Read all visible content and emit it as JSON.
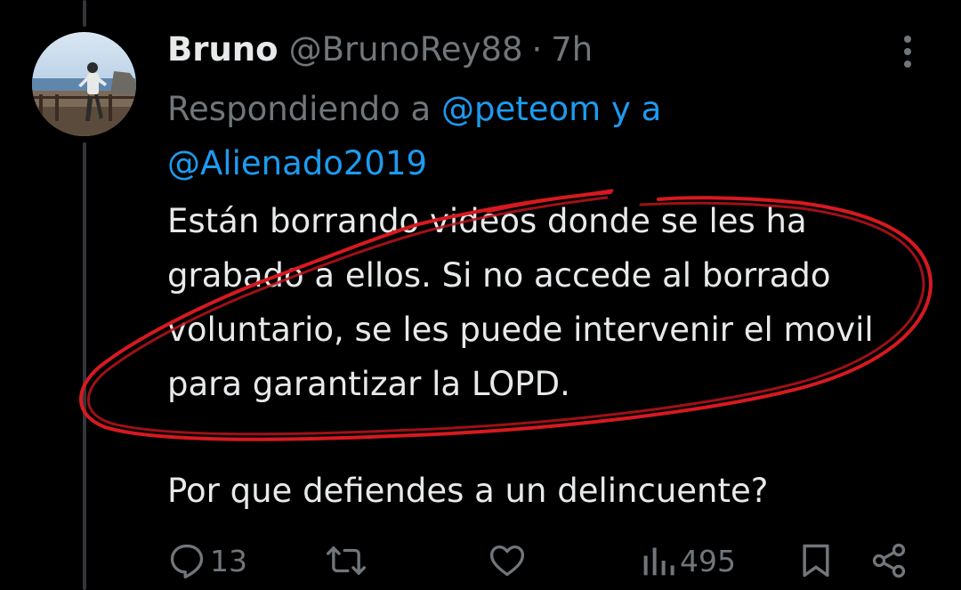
{
  "tweet": {
    "display_name": "Bruno",
    "handle": "@BrunoRey88",
    "separator": "·",
    "time": "7h",
    "reply_prefix": "Respondiendo a",
    "mention_1": "@peteom",
    "reply_connector": "y a",
    "mention_2": "@Alienado2019",
    "paragraph_1": "Están borrando videos donde se les ha grabado a ellos. Si no accede al borrado voluntario, se les puede intervenir el movil para garantizar la LOPD.",
    "paragraph_2": "Por que defiendes a un delincuente?"
  },
  "actions": {
    "reply_count": "13",
    "views_count": "495"
  },
  "icons": {
    "more": "more-vertical-icon",
    "reply": "reply-icon",
    "retweet": "retweet-icon",
    "like": "heart-icon",
    "views": "views-icon",
    "bookmark": "bookmark-icon",
    "share": "share-icon"
  },
  "colors": {
    "background": "#000000",
    "text": "#e7e9ea",
    "muted": "#71767b",
    "link": "#1d9bf0",
    "annotation": "#d71920"
  }
}
